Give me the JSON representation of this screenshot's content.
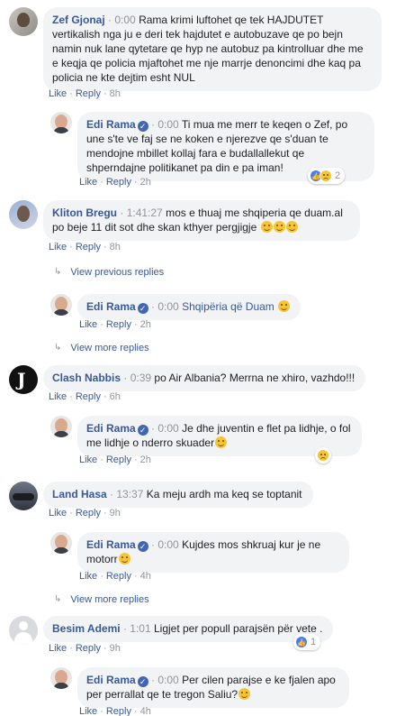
{
  "actions": {
    "like": "Like",
    "reply": "Reply",
    "sep": "·"
  },
  "comments": [
    {
      "name": "Zef Gjonaj",
      "timestamp": "0:00",
      "text": "Rama krimi luftohet qe tek HAJDUTET vertikalish nga ju e deri tek hajdutet e autobuzave qe po bejn namin nuk lane qytetare qe hyp ne autobuz pa kintrolluar dhe me e keqja qe policia mjaftohet me nje marrje denoncimi dhe kaq pa policia ne kte dejtim esht NUL",
      "age": "8h",
      "reply": {
        "name": "Edi Rama",
        "timestamp": "0:00",
        "text": "Ti mua me merr te keqen o Zef, po une s'te ve faj se ne koken e njerezve qe s'duan te mendojne mbillet kollaj fara e budallallekut qe shperndajne politikanet pa din e pa iman!",
        "age": "2h",
        "reaction_count": "2"
      }
    },
    {
      "name": "Kliton Bregu",
      "timestamp": "1:41:27",
      "text": "mos e thuaj me shqiperia qe duam.al po beje 11 dit sot dhe skan kthyer pergjigje",
      "age": "8h",
      "view_previous": "View previous replies",
      "reply": {
        "name": "Edi Rama",
        "timestamp": "0:00",
        "text": "Shqipëria që Duam",
        "age": "2h"
      },
      "view_more": "View more replies"
    },
    {
      "name": "Clash Nabbis",
      "timestamp": "0:39",
      "text": "po Air Albania? Merrna ne xhiro, vazhdo!!!",
      "age": "6h",
      "reply": {
        "name": "Edi Rama",
        "timestamp": "0:00",
        "text": "Je dhe juventin e flet pa lidhje, o fol me lidhje o nderro skuader",
        "age": "2h"
      }
    },
    {
      "name": "Land Hasa",
      "timestamp": "13:37",
      "text": "Ka meju ardh ma keq se toptanit",
      "age": "9h",
      "reply": {
        "name": "Edi Rama",
        "timestamp": "0:00",
        "text": "Kujdes mos shkruaj kur je ne motorr",
        "age": "4h"
      },
      "view_more": "View more replies"
    },
    {
      "name": "Besim Ademi",
      "timestamp": "1:01",
      "text": "Ligjet per popull parajsën për vete .",
      "age": "9h",
      "reaction_count": "1",
      "reply": {
        "name": "Edi Rama",
        "timestamp": "0:00",
        "text": "Per cilen parajse e ke fjalen apo per perrallat qe te tregon Saliu?",
        "age": "4h"
      }
    }
  ]
}
